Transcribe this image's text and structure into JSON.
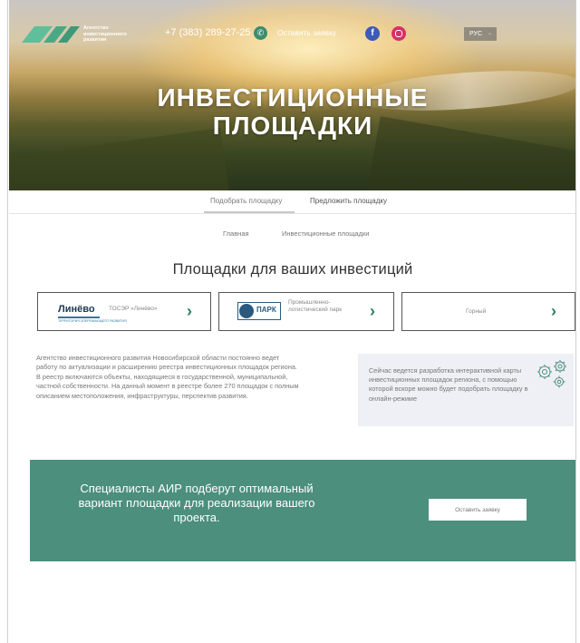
{
  "header": {
    "logo_text": "Агентство инвестиционного развития",
    "phone": "+7 (383) 289-27-25",
    "request_link": "Оставить заявку",
    "social": {
      "facebook_icon": "facebook-icon",
      "instagram_icon": "instagram-icon"
    },
    "language": "РУС"
  },
  "hero": {
    "title_line1": "ИНВЕСТИЦИОННЫЕ",
    "title_line2": "ПЛОЩАДКИ"
  },
  "tabs": [
    {
      "label": "Подобрать площадку",
      "active": true
    },
    {
      "label": "Предложить площадку",
      "active": false
    }
  ],
  "breadcrumb": {
    "home": "Главная",
    "current": "Инвестиционные площадки"
  },
  "section_title": "Площадки для ваших инвестиций",
  "cards": [
    {
      "logo": "Линёво",
      "logo_tag": "ТЕРРИТОРИЯ ОПЕРЕЖАЮЩЕГО РАЗВИТИЯ",
      "subtitle": "ТОСЭР «Линёво»"
    },
    {
      "logo": "ПАРК",
      "subtitle": "Промышленно-логистический парк"
    },
    {
      "subtitle": "Горный"
    }
  ],
  "about_text": "Агентство инвестиционного развития Новосибирской области постоянно ведет работу по актуализации и расширению реестра инвестиционных площадок региона. В реестр включаются объекты, находящиеся в государственной, муниципальной, частной собственности. На данный момент в реестре более 270 площадок с полным описанием местоположения, инфраструктуры, перспектив развития.",
  "info_box": {
    "text": "Сейчас ведется разработка интерактивной карты инвестиционных площадок региона, с помощью которой вскоре можно будет подобрать площадку в онлайн-режиме",
    "icon": "gears-icon"
  },
  "cta": {
    "text": "Специалисты АИР подберут оптимальный вариант площадки для реализации вашего проекта.",
    "button": "Оставить заявку"
  },
  "colors": {
    "accent": "#4b8f7c",
    "chevron": "#2f7e68",
    "info_bg": "#eef0f5"
  }
}
